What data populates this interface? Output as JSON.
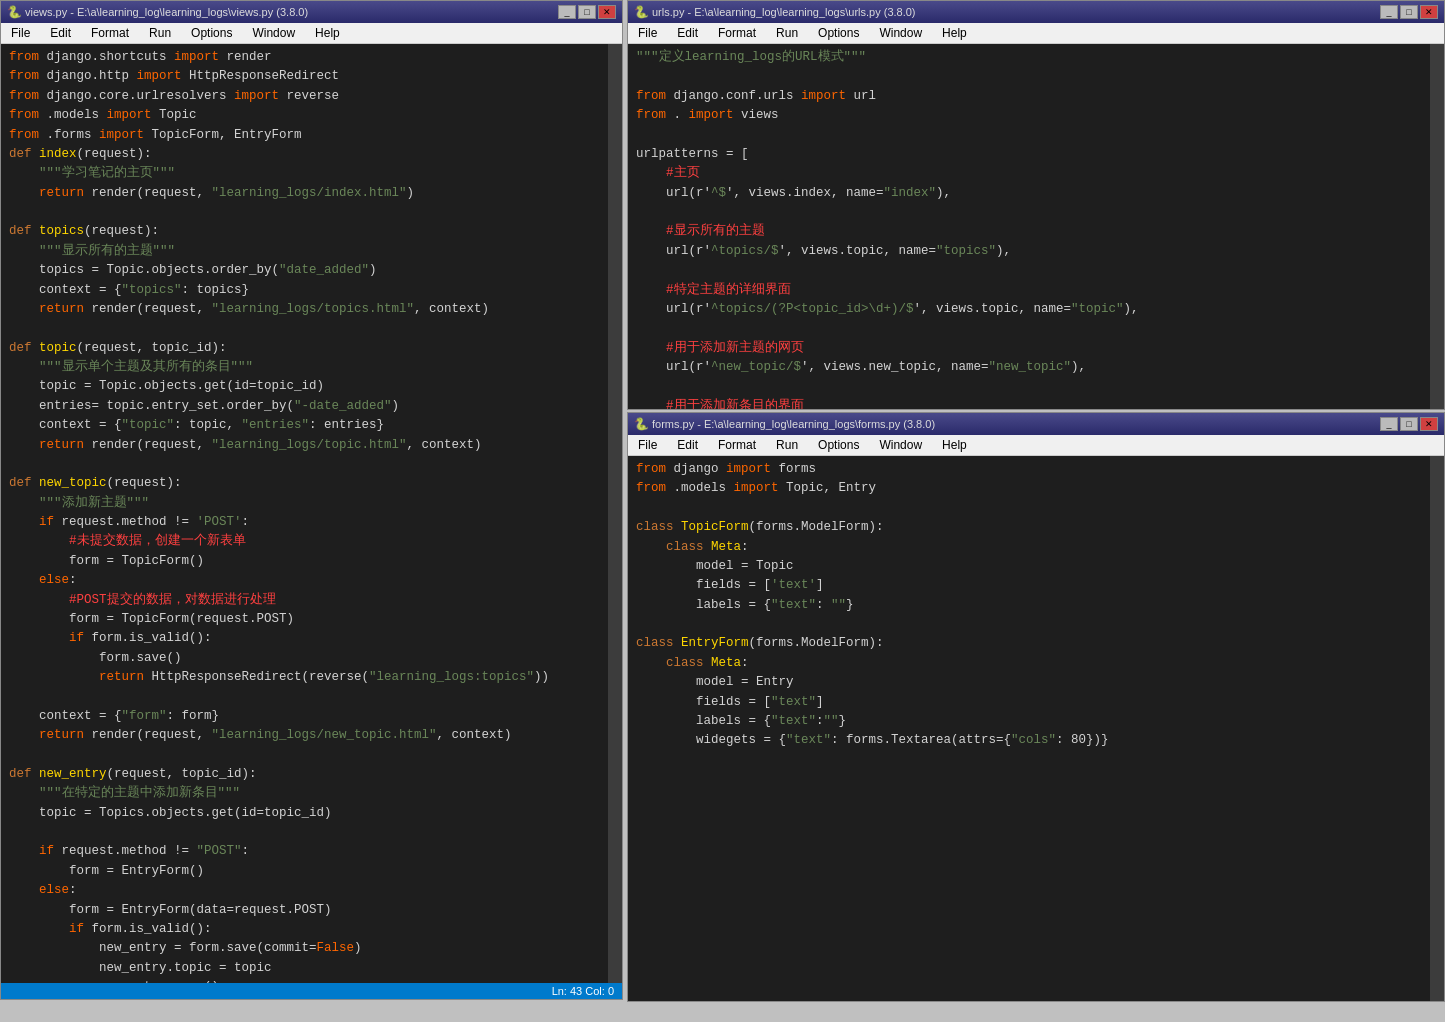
{
  "windows": {
    "views": {
      "title": "views.py - E:\\a\\learning_log\\learning_logs\\views.py (3.8.0)",
      "icon": "🐍",
      "status": "Ln: 43   Col: 0",
      "menu": [
        "File",
        "Edit",
        "Format",
        "Run",
        "Options",
        "Window",
        "Help"
      ]
    },
    "urls": {
      "title": "urls.py - E:\\a\\learning_log\\learning_logs\\urls.py (3.8.0)",
      "icon": "🐍",
      "menu": [
        "File",
        "Edit",
        "Format",
        "Run",
        "Options",
        "Window",
        "Help"
      ]
    },
    "forms": {
      "title": "forms.py - E:\\a\\learning_log\\learning_logs\\forms.py (3.8.0)",
      "icon": "🐍",
      "menu": [
        "File",
        "Edit",
        "Format",
        "Run",
        "Options",
        "Window",
        "Help"
      ]
    }
  }
}
